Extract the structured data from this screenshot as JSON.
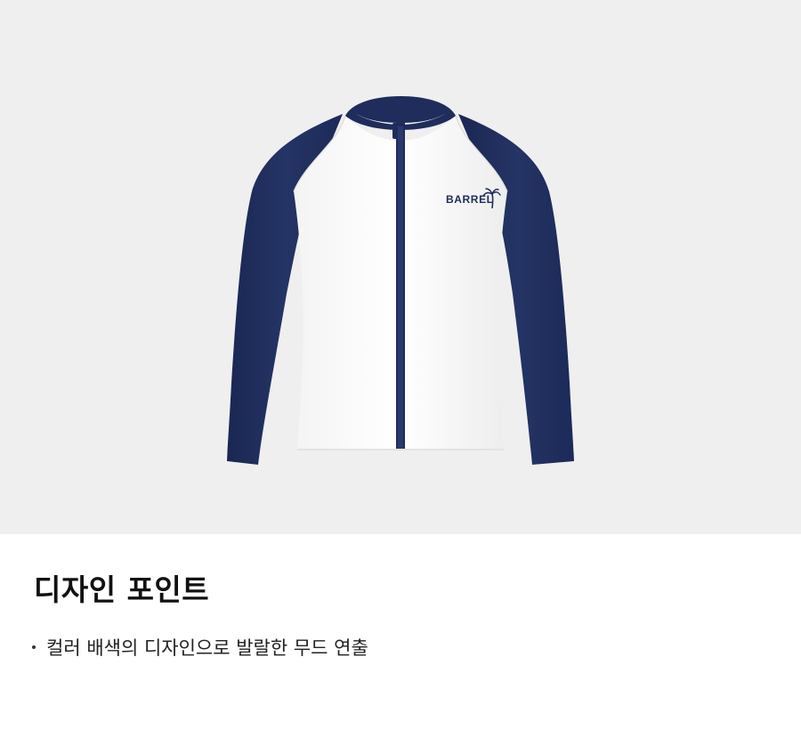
{
  "product_image": {
    "logo_text": "BARREL",
    "colors": {
      "sleeve": "#1e2d5c",
      "body": "#ffffff",
      "background": "#efefef",
      "zipper": "#1e2d5c"
    }
  },
  "design_point": {
    "title": "디자인 포인트",
    "bullets": [
      "컬러 배색의 디자인으로 발랄한 무드 연출"
    ]
  }
}
